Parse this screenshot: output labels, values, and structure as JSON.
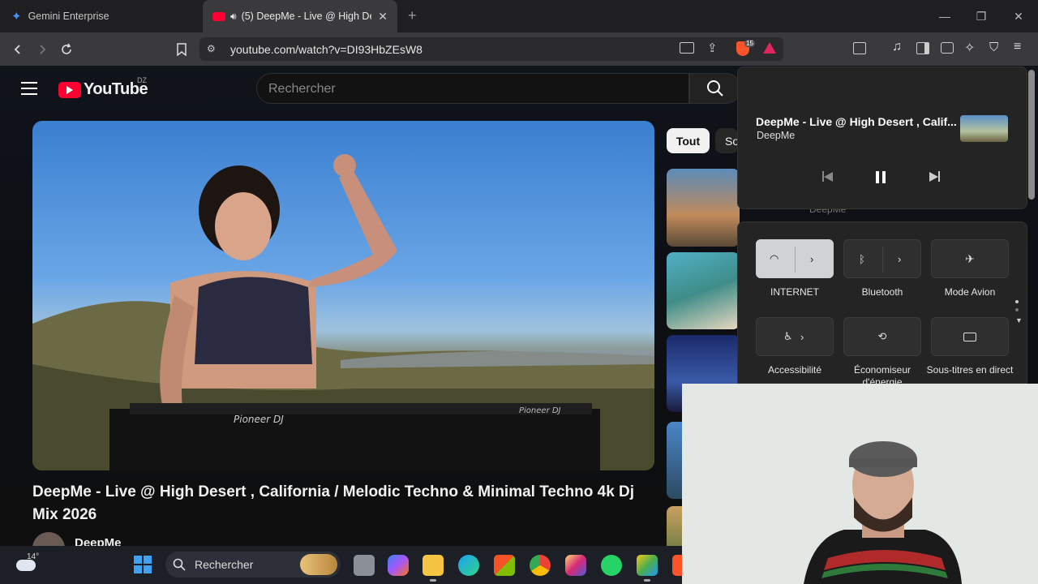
{
  "browser": {
    "tabs": [
      {
        "label": "Gemini Enterprise",
        "active": false
      },
      {
        "label": "(5) DeepMe - Live @ High De",
        "active": true
      }
    ],
    "url": "youtube.com/watch?v=DI93HbZEsW8",
    "shield_count": "15"
  },
  "youtube": {
    "logo_text": "YouTube",
    "region": "DZ",
    "search_placeholder": "Rechercher",
    "chips": [
      "Tout",
      "So"
    ],
    "video_title": "DeepMe - Live @ High Desert , California / Melodic Techno & Minimal Techno 4k Dj Mix 2026",
    "channel": "DeepMe",
    "sidebar_channel": "DeepMe",
    "watermark_text": "Pioneer DJ"
  },
  "media_flyout": {
    "title": "DeepMe - Live @ High Desert , Calif...",
    "artist": "DeepMe"
  },
  "quick_settings": {
    "tiles": [
      {
        "label": "INTERNET",
        "icon": "wifi-icon",
        "active": true
      },
      {
        "label": "Bluetooth",
        "icon": "bluetooth-icon",
        "active": false
      },
      {
        "label": "Mode Avion",
        "icon": "airplane-icon",
        "active": false
      },
      {
        "label": "Accessibilité",
        "icon": "accessibility-icon",
        "active": false
      },
      {
        "label": "Économiseur d'énergie",
        "icon": "battery-saver-icon",
        "active": false
      },
      {
        "label": "Sous-titres en direct",
        "icon": "captions-icon",
        "active": false
      }
    ]
  },
  "taskbar": {
    "weather": "14°",
    "search_label": "Rechercher"
  },
  "colors": {
    "yt_red": "#ff0033",
    "chrome_bg": "#3a3a3d",
    "flyout_bg": "#242424"
  }
}
